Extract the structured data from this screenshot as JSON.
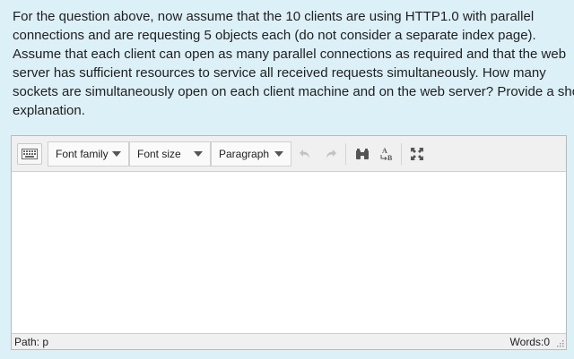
{
  "question": {
    "lines": [
      " For the question above, now assume that the 10 clients are using HTTP1.0 with parallel",
      "connections and are requesting 5 objects each (do not consider a separate index page).",
      "Assume that each client can open as many parallel connections as required and that the web",
      "server has sufficient resources to service all received requests simultaneously. How many",
      "sockets are simultaneously open on each client machine and on the web server? Provide a short",
      "explanation."
    ]
  },
  "toolbar": {
    "font_family": "Font family",
    "font_size": "Font size",
    "block_format": "Paragraph",
    "icons": {
      "keyboard": "keyboard-icon",
      "undo": "undo-icon",
      "redo": "redo-icon",
      "find": "binoculars-icon",
      "replace": "find-replace-icon",
      "fullscreen": "fullscreen-icon"
    }
  },
  "statusbar": {
    "path": "Path: p",
    "words": "Words:0"
  },
  "colors": {
    "page_background": "#dcf0f7",
    "toolbar_background": "#f0f0f0",
    "editor_background": "#ffffff"
  }
}
